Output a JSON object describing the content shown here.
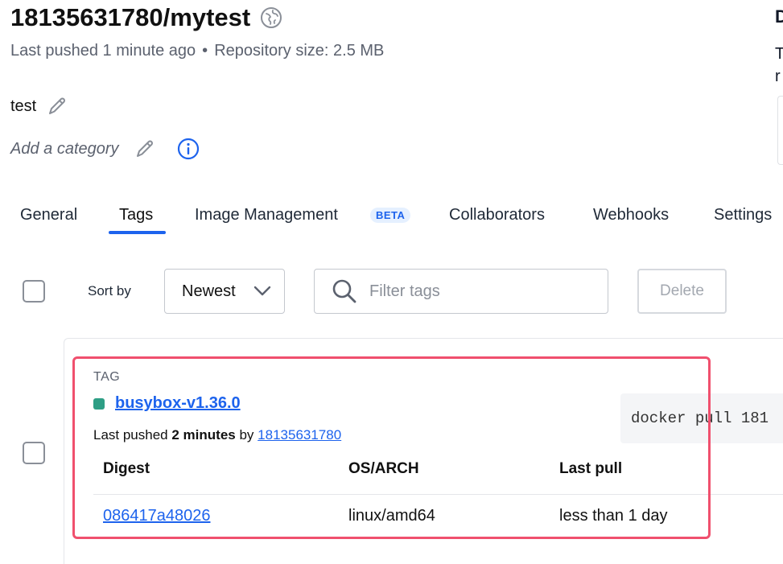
{
  "repo": {
    "title": "18135631780/mytest",
    "last_pushed": "Last pushed 1 minute ago",
    "separator": "•",
    "repo_size": "Repository size: 2.5 MB",
    "description": "test",
    "category_placeholder": "Add a category"
  },
  "right_column": {
    "heading_fragment": "D",
    "text_fragment_1": "T",
    "text_fragment_2": "r"
  },
  "tabs": [
    {
      "label": "General",
      "active": false
    },
    {
      "label": "Tags",
      "active": true
    },
    {
      "label": "Image Management",
      "active": false
    },
    {
      "label": "Collaborators",
      "active": false
    },
    {
      "label": "Webhooks",
      "active": false
    },
    {
      "label": "Settings",
      "active": false
    }
  ],
  "beta_badge": "BETA",
  "toolbar": {
    "sort_label": "Sort by",
    "sort_value": "Newest",
    "filter_placeholder": "Filter tags",
    "delete_label": "Delete"
  },
  "tag": {
    "section_label": "TAG",
    "name": "busybox-v1.36.0",
    "status_color": "#2e9e85",
    "pushed_prefix": "Last pushed",
    "pushed_time": "2 minutes",
    "pushed_by_word": "by",
    "pushed_by": "18135631780",
    "columns": [
      "Digest",
      "OS/ARCH",
      "Last pull"
    ],
    "rows": [
      {
        "digest": "086417a48026",
        "os_arch": "linux/amd64",
        "last_pull": "less than 1 day"
      }
    ],
    "pull_command": "docker pull 181"
  },
  "colors": {
    "accent": "#1d63ed",
    "highlight": "#f0506e"
  }
}
